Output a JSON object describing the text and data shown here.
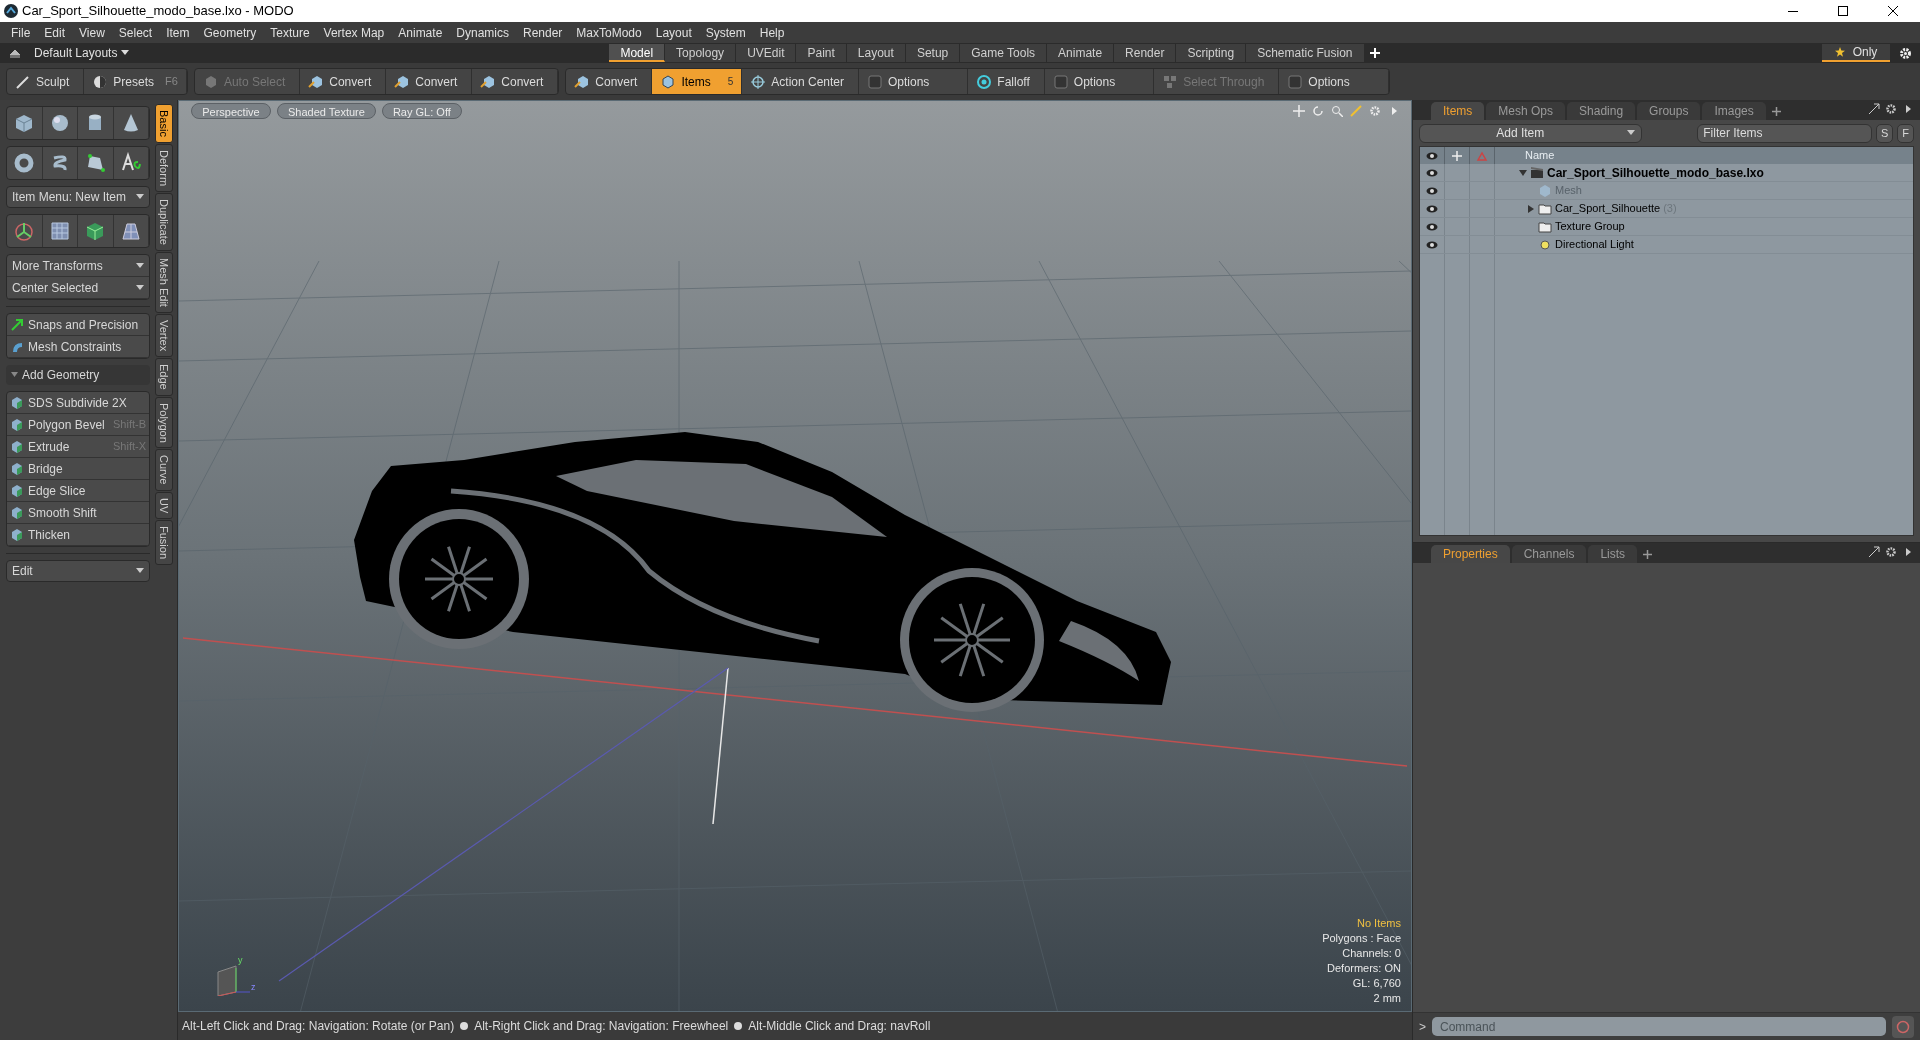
{
  "window": {
    "title": "Car_Sport_Silhouette_modo_base.lxo - MODO"
  },
  "menu": [
    "File",
    "Edit",
    "View",
    "Select",
    "Item",
    "Geometry",
    "Texture",
    "Vertex Map",
    "Animate",
    "Dynamics",
    "Render",
    "MaxToModo",
    "Layout",
    "System",
    "Help"
  ],
  "layouts": {
    "label": "Default Layouts",
    "only": "Only",
    "tabs": [
      {
        "label": "Model",
        "selected": true
      },
      {
        "label": "Topology",
        "selected": false
      },
      {
        "label": "UVEdit",
        "selected": false
      },
      {
        "label": "Paint",
        "selected": false
      },
      {
        "label": "Layout",
        "selected": false
      },
      {
        "label": "Setup",
        "selected": false
      },
      {
        "label": "Game Tools",
        "selected": false
      },
      {
        "label": "Animate",
        "selected": false
      },
      {
        "label": "Render",
        "selected": false
      },
      {
        "label": "Scripting",
        "selected": false
      },
      {
        "label": "Schematic Fusion",
        "selected": false
      }
    ]
  },
  "toolbar": [
    [
      {
        "kind": "sculpt",
        "label": "Sculpt"
      },
      {
        "kind": "presets",
        "label": "Presets",
        "shortcut": "F6"
      }
    ],
    [
      {
        "kind": "auto",
        "label": "Auto Select",
        "disabled": true
      },
      {
        "kind": "convert",
        "label": "Convert"
      },
      {
        "kind": "convert",
        "label": "Convert"
      },
      {
        "kind": "convert",
        "label": "Convert"
      }
    ],
    [
      {
        "kind": "convert",
        "label": "Convert"
      },
      {
        "kind": "items",
        "label": "Items",
        "selected": true,
        "badge": "5"
      },
      {
        "kind": "action",
        "label": "Action Center"
      },
      {
        "kind": "options",
        "label": "Options"
      },
      {
        "kind": "falloff",
        "label": "Falloff"
      },
      {
        "kind": "options",
        "label": "Options"
      },
      {
        "kind": "through",
        "label": "Select Through",
        "disabled": true
      },
      {
        "kind": "options",
        "label": "Options"
      }
    ]
  ],
  "left_panel": {
    "item_menu": "Item Menu: New Item",
    "transforms": [
      "More Transforms",
      "Center Selected"
    ],
    "constraints": [
      "Snaps and Precision",
      "Mesh Constraints"
    ],
    "section": "Add Geometry",
    "tools": [
      {
        "label": "SDS Subdivide 2X"
      },
      {
        "label": "Polygon Bevel",
        "shortcut": "Shift-B"
      },
      {
        "label": "Extrude",
        "shortcut": "Shift-X"
      },
      {
        "label": "Bridge"
      },
      {
        "label": "Edge Slice"
      },
      {
        "label": "Smooth Shift"
      },
      {
        "label": "Thicken"
      }
    ],
    "edit": "Edit",
    "side_tabs": [
      {
        "label": "Basic",
        "selected": true
      },
      {
        "label": "Deform",
        "selected": false
      },
      {
        "label": "Duplicate",
        "selected": false
      },
      {
        "label": "Mesh Edit",
        "selected": false
      },
      {
        "label": "Vertex",
        "selected": false
      },
      {
        "label": "Edge",
        "selected": false
      },
      {
        "label": "Polygon",
        "selected": false
      },
      {
        "label": "Curve",
        "selected": false
      },
      {
        "label": "UV",
        "selected": false
      },
      {
        "label": "Fusion",
        "selected": false
      }
    ]
  },
  "viewport": {
    "axis_labels": [
      "y",
      "z"
    ],
    "buttons": [
      "Perspective",
      "Shaded Texture",
      "Ray GL: Off"
    ],
    "stats": [
      {
        "text": "No Items",
        "kind": "highlight"
      },
      {
        "text": "Polygons : Face",
        "kind": "plain"
      },
      {
        "text": "Channels: 0",
        "kind": "plain"
      },
      {
        "text": "Deformers: ON",
        "kind": "plain"
      },
      {
        "text": "GL: 6,760",
        "kind": "plain"
      },
      {
        "text": "2 mm",
        "kind": "plain"
      }
    ]
  },
  "items_panel": {
    "tabs": [
      {
        "label": "Items",
        "selected": true
      },
      {
        "label": "Mesh Ops",
        "selected": false
      },
      {
        "label": "Shading",
        "selected": false
      },
      {
        "label": "Groups",
        "selected": false
      },
      {
        "label": "Images",
        "selected": false
      }
    ],
    "add_item": "Add Item",
    "filter": {
      "placeholder": "Filter Items"
    },
    "filter_buttons": [
      "S",
      "F"
    ],
    "column": "Name",
    "tree": [
      {
        "label": "Car_Sport_Silhouette_modo_base.lxo",
        "kind": "scene",
        "expanded": true,
        "children": [
          {
            "label": "Mesh",
            "kind": "mesh",
            "disabled": true
          },
          {
            "label": "Car_Sport_Silhouette",
            "count": "(3)",
            "kind": "group",
            "expanded": false
          },
          {
            "label": "Texture Group",
            "kind": "group"
          },
          {
            "label": "Directional Light",
            "kind": "light"
          }
        ]
      }
    ]
  },
  "properties_panel": {
    "tabs": [
      {
        "label": "Properties",
        "selected": true
      },
      {
        "label": "Channels",
        "selected": false
      },
      {
        "label": "Lists",
        "selected": false
      }
    ]
  },
  "status_bar": [
    "Alt-Left Click and Drag: Navigation: Rotate (or Pan)",
    "Alt-Right Click and Drag: Navigation: Freewheel",
    "Alt-Middle Click and Drag: navRoll"
  ],
  "command": {
    "prompt": ">",
    "placeholder": "Command"
  }
}
